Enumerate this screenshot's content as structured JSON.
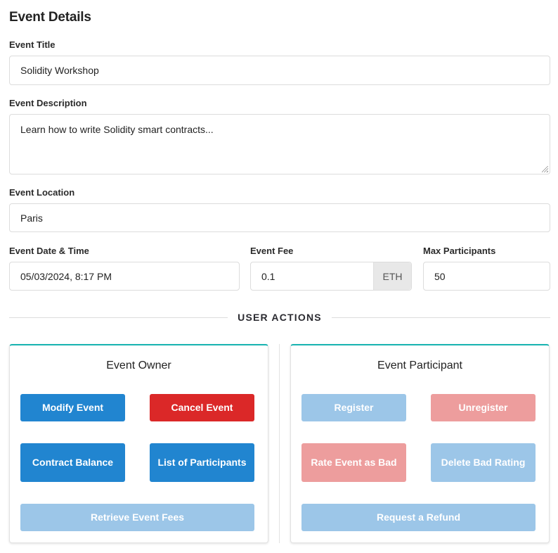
{
  "page_title": "Event Details",
  "fields": {
    "title": {
      "label": "Event Title",
      "value": "Solidity Workshop"
    },
    "description": {
      "label": "Event Description",
      "value": "Learn how to write Solidity smart contracts..."
    },
    "location": {
      "label": "Event Location",
      "value": "Paris"
    },
    "datetime": {
      "label": "Event Date & Time",
      "value": "05/03/2024, 8:17 PM"
    },
    "fee": {
      "label": "Event Fee",
      "value": "0.1",
      "unit": "ETH"
    },
    "max_participants": {
      "label": "Max Participants",
      "value": "50"
    }
  },
  "divider_label": "USER ACTIONS",
  "owner_panel": {
    "title": "Event Owner",
    "buttons": {
      "modify": {
        "label": "Modify Event",
        "enabled": true
      },
      "cancel": {
        "label": "Cancel Event",
        "enabled": true
      },
      "balance": {
        "label": "Contract Balance",
        "enabled": true
      },
      "participants": {
        "label": "List of Participants",
        "enabled": true
      },
      "retrieve_fees": {
        "label": "Retrieve Event Fees",
        "enabled": false
      }
    }
  },
  "participant_panel": {
    "title": "Event Participant",
    "buttons": {
      "register": {
        "label": "Register",
        "enabled": false
      },
      "unregister": {
        "label": "Unregister",
        "enabled": false
      },
      "rate_bad": {
        "label": "Rate Event as Bad",
        "enabled": false
      },
      "delete_rating": {
        "label": "Delete Bad Rating",
        "enabled": false
      },
      "refund": {
        "label": "Request a Refund",
        "enabled": false
      }
    }
  },
  "colors": {
    "primary": "#2185d0",
    "danger": "#db2828",
    "card_accent": "#17b3b0"
  }
}
